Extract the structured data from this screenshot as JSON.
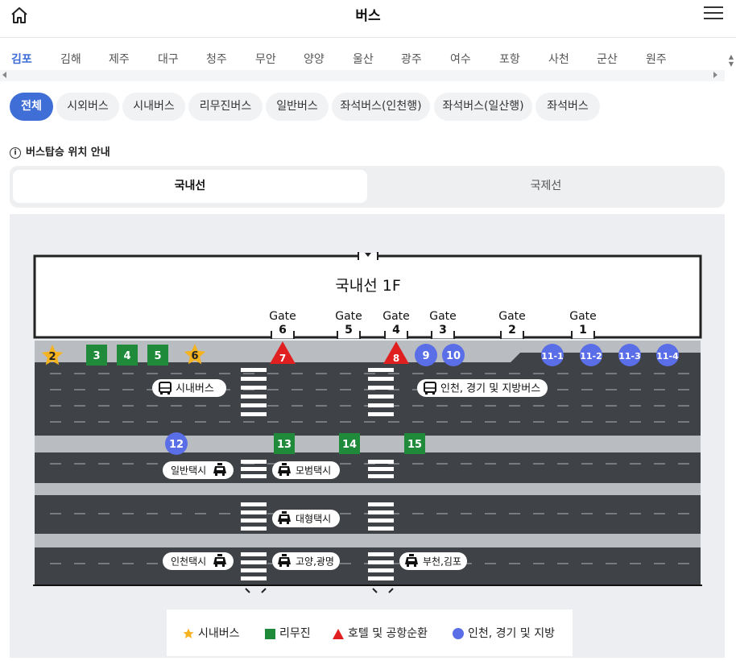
{
  "header": {
    "title": "버스",
    "home_icon": "home-icon",
    "menu_icon": "menu-icon"
  },
  "cities": [
    "김포",
    "김해",
    "제주",
    "대구",
    "청주",
    "무안",
    "양양",
    "울산",
    "광주",
    "여수",
    "포항",
    "사천",
    "군산",
    "원주"
  ],
  "active_city": "김포",
  "filters": [
    "전체",
    "시외버스",
    "시내버스",
    "리무진버스",
    "일반버스",
    "좌석버스(인천행)",
    "좌석버스(일산행)",
    "좌석버스"
  ],
  "active_filter": "전체",
  "location_title": "버스탑승 위치 안내",
  "tabs": {
    "domestic": "국내선",
    "international": "국제선"
  },
  "map": {
    "floor_label": "국내선 1F",
    "gate_word": "Gate",
    "gates": [
      "6",
      "5",
      "4",
      "3",
      "2",
      "1"
    ],
    "stops_row1": {
      "city_bus": [
        "2",
        "6"
      ],
      "limousine": [
        "3",
        "4",
        "5"
      ],
      "hotel_shuttle": [
        "7",
        "8"
      ],
      "regional": [
        "9",
        "10",
        "11-1",
        "11-2",
        "11-3",
        "11-4"
      ]
    },
    "stops_row2": {
      "regional": [
        "12"
      ],
      "limousine": [
        "13",
        "14",
        "15"
      ]
    },
    "labels": {
      "city_bus": "시내버스",
      "regional_bus": "인천, 경기 및 지방버스",
      "general_taxi": "일반택시",
      "model_taxi": "모범택시",
      "large_taxi": "대형택시",
      "incheon_taxi": "인천택시",
      "goyang_taxi": "고양,광명",
      "bucheon_taxi": "부천,김포"
    },
    "colors": {
      "star": "#f5b31f",
      "limousine": "#1e8a3a",
      "hotel": "#e02020",
      "regional": "#5a6ee8",
      "road": "#3f4347"
    }
  },
  "legend": {
    "city_bus": "시내버스",
    "limousine": "리무진",
    "hotel": "호텔 및 공항순환",
    "regional": "인천, 경기 및 지방"
  }
}
